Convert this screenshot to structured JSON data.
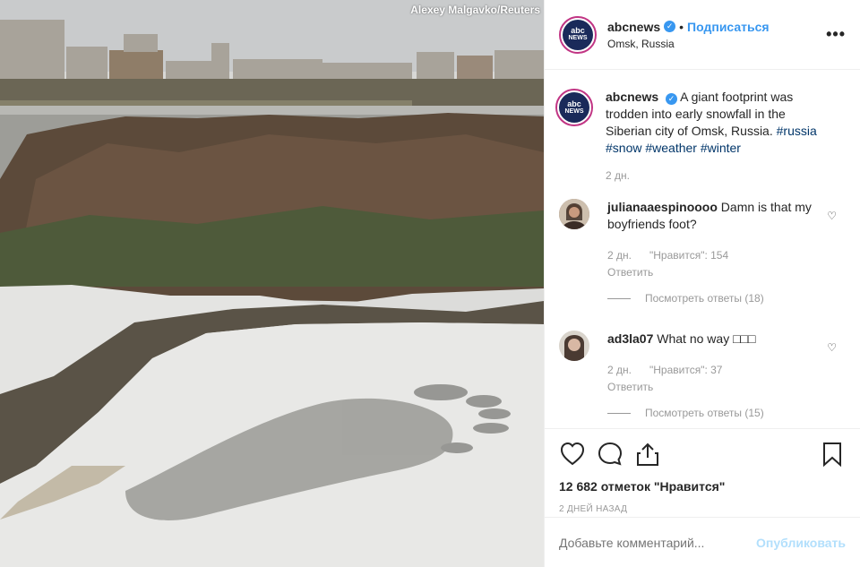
{
  "photo": {
    "credit": "Alexey Malgavko/Reuters"
  },
  "header": {
    "username": "abcnews",
    "follow_label": "Подписаться",
    "location": "Omsk, Russia",
    "more_label": "•••",
    "avatar_lines": [
      "abc",
      "NEWS"
    ]
  },
  "caption": {
    "username": "abcnews",
    "text": "A giant footprint was trodden into early snowfall in the Siberian city of Omsk, Russia.",
    "hashtags": "#russia #snow #weather #winter",
    "time": "2 дн."
  },
  "comments": [
    {
      "username": "julianaaespinoooo",
      "text": "Damn is that my boyfriends foot?",
      "time": "2 дн.",
      "likes": "\"Нравится\": 154",
      "reply_label": "Ответить",
      "view_replies": "Посмотреть ответы (18)"
    },
    {
      "username": "ad3la07",
      "text": "What no way □□□",
      "time": "2 дн.",
      "likes": "\"Нравится\": 37",
      "reply_label": "Ответить",
      "view_replies": "Посмотреть ответы (15)"
    }
  ],
  "actions": {
    "likes_count": "12 682 отметок \"Нравится\"",
    "date": "2 ДНЕЙ НАЗАД"
  },
  "add_comment": {
    "placeholder": "Добавьте комментарий...",
    "publish_label": "Опубликовать"
  },
  "colors": {
    "accent": "#3897f0",
    "publish_disabled": "#b2dffc",
    "muted": "#999999"
  }
}
